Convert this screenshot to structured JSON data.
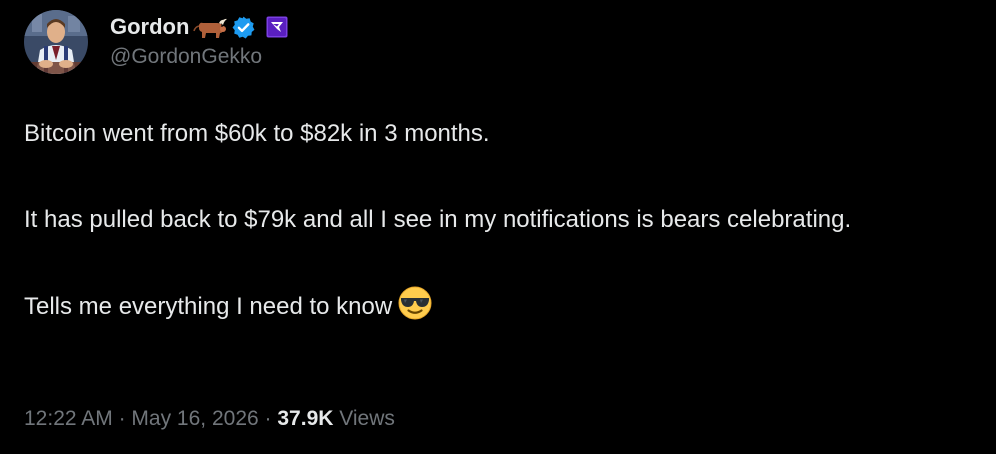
{
  "author": {
    "display_name": "Gordon",
    "handle": "@GordonGekko",
    "name_emoji": "bull-icon",
    "verified_badge": "verified-badge-icon",
    "affiliate_badge": "affiliate-badge-icon"
  },
  "tweet": {
    "paragraphs": [
      "Bitcoin went from $60k to $82k in 3 months.",
      "It has pulled back to $79k and all I see in my notifications is bears celebrating.",
      "Tells me everything I need to know"
    ],
    "trailing_emoji": "sunglasses-face-icon"
  },
  "meta": {
    "time": "12:22 AM",
    "separator": "·",
    "date": "May 16, 2026",
    "views_count": "37.9K",
    "views_label": "Views"
  },
  "colors": {
    "background": "#000000",
    "primary_text": "#e7e9ea",
    "secondary_text": "#71767b",
    "verified_blue": "#1d9bf0",
    "affiliate_purple": "#7b3fe4"
  }
}
